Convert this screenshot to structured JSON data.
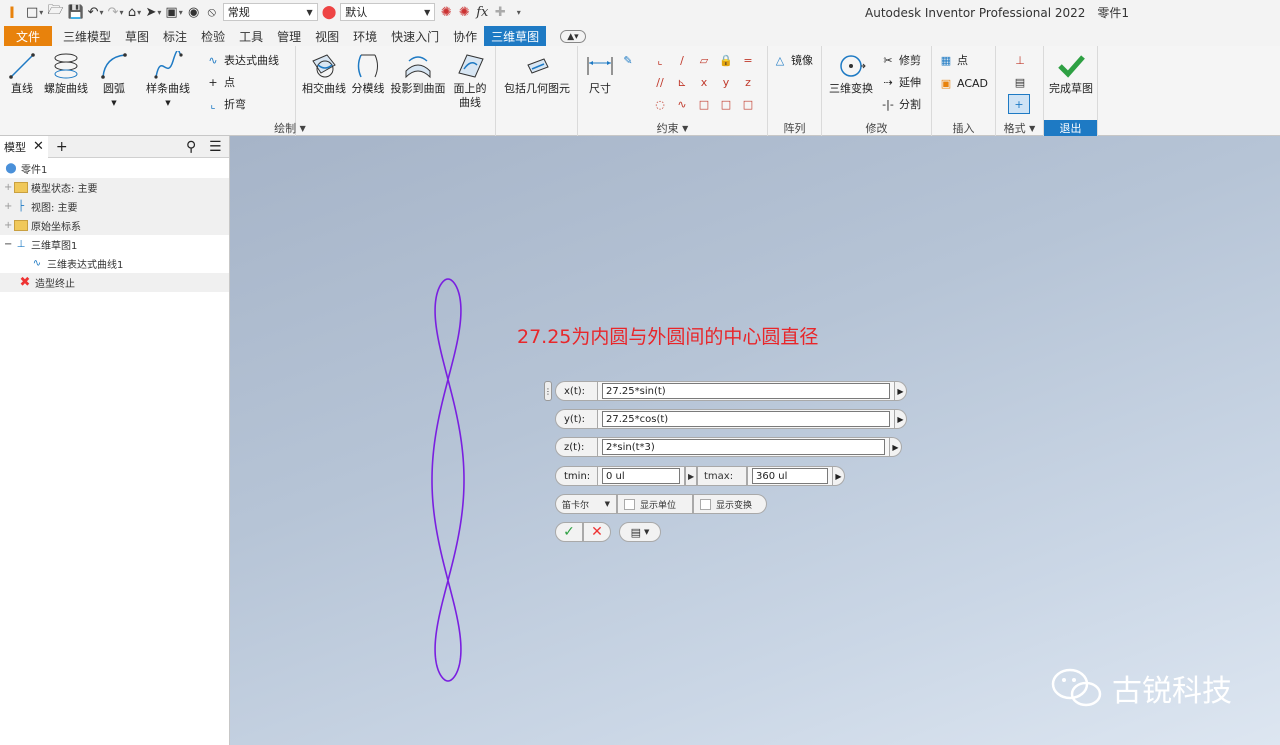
{
  "titlebar": {
    "style_combo": "常规",
    "appearance_combo": "默认",
    "fx": "fx",
    "app_title": "Autodesk Inventor Professional 2022",
    "document": "零件1"
  },
  "tabs": [
    "文件",
    "三维模型",
    "草图",
    "标注",
    "检验",
    "工具",
    "管理",
    "视图",
    "环境",
    "快速入门",
    "协作",
    "三维草图"
  ],
  "ribbon": {
    "draw": {
      "line": "直线",
      "helix": "螺旋曲线",
      "arc": "圆弧",
      "spline": "样条曲线",
      "equation": "表达式曲线",
      "point": "点",
      "bend": "折弯",
      "intersect": "相交曲线",
      "silhouette": "分模线",
      "project_surface": "投影到曲面",
      "curve_on_face_1": "面上的",
      "curve_on_face_2": "曲线",
      "title": "绘制"
    },
    "include": {
      "label": "包括几何图元"
    },
    "constrain": {
      "dimension": "尺寸",
      "title": "约束"
    },
    "pattern": {
      "mirror": "镜像",
      "title": "阵列"
    },
    "modify": {
      "transform": "三维变换",
      "trim": "修剪",
      "extend": "延伸",
      "split": "分割",
      "title": "修改"
    },
    "insert": {
      "point": "点",
      "acad": "ACAD",
      "title": "插入"
    },
    "format": {
      "title": "格式"
    },
    "exit": {
      "finish": "完成草图",
      "title": "退出"
    }
  },
  "browser": {
    "tab": "模型",
    "items": [
      "零件1",
      "模型状态: 主要",
      "视图: 主要",
      "原始坐标系",
      "三维草图1",
      "三维表达式曲线1",
      "造型终止"
    ]
  },
  "annotation": "27.25为内圆与外圆间的中心圆直径",
  "equation": {
    "x_label": "x(t):",
    "x_value": "27.25*sin(t)",
    "y_label": "y(t):",
    "y_value": "27.25*cos(t)",
    "z_label": "z(t):",
    "z_value": "2*sin(t*3)",
    "tmin_label": "tmin:",
    "tmin_value": "0 ul",
    "tmax_label": "tmax:",
    "tmax_value": "360 ul",
    "coord_system": "笛卡尔",
    "show_units": "显示单位",
    "show_transform": "显示变换"
  },
  "watermark": "古锐科技",
  "colors": {
    "accent": "#1e7ac4",
    "file_tab": "#e8820c",
    "curve": "#7a1fe0",
    "annotation": "#e8262a"
  }
}
